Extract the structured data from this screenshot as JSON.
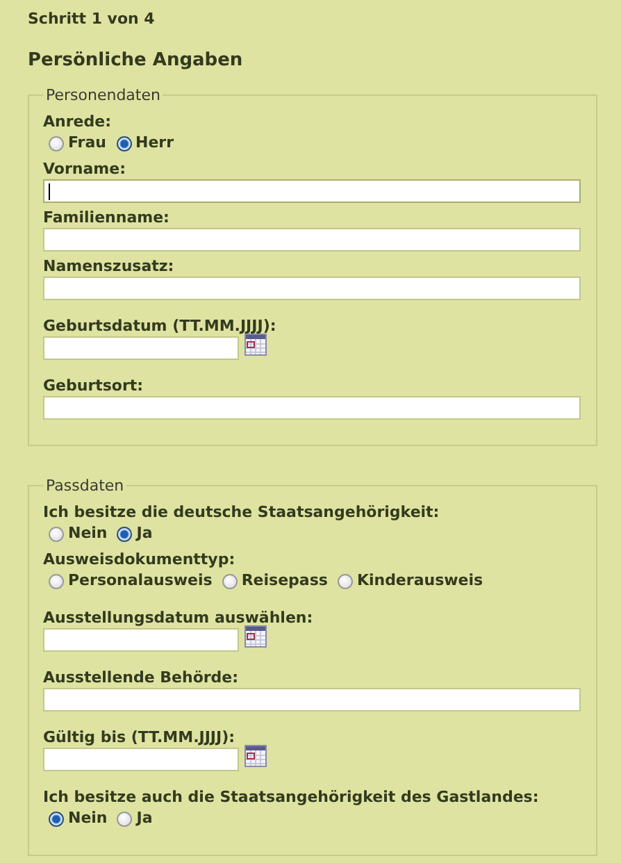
{
  "step": "Schritt 1 von 4",
  "heading": "Persönliche Angaben",
  "sections": [
    {
      "legend": "Personendaten",
      "fields": [
        {
          "kind": "radio",
          "label": "Anrede:",
          "options": [
            {
              "label": "Frau",
              "selected": false
            },
            {
              "label": "Herr",
              "selected": true
            }
          ]
        },
        {
          "kind": "text",
          "label": "Vorname:",
          "focused": true
        },
        {
          "kind": "text",
          "label": "Familienname:",
          "focused": false
        },
        {
          "kind": "text",
          "label": "Namenszusatz:",
          "focused": false
        },
        {
          "kind": "date",
          "label": "Geburtsdatum (TT.MM.JJJJ):"
        },
        {
          "kind": "text",
          "label": "Geburtsort:",
          "focused": false
        }
      ]
    },
    {
      "legend": "Passdaten",
      "fields": [
        {
          "kind": "radio",
          "label": "Ich besitze die deutsche Staatsangehörigkeit:",
          "options": [
            {
              "label": "Nein",
              "selected": false
            },
            {
              "label": "Ja",
              "selected": true
            }
          ]
        },
        {
          "kind": "radio",
          "label": "Ausweisdokumenttyp:",
          "options": [
            {
              "label": "Personalausweis",
              "selected": false
            },
            {
              "label": "Reisepass",
              "selected": false
            },
            {
              "label": "Kinderausweis",
              "selected": false
            }
          ]
        },
        {
          "kind": "date",
          "label": "Ausstellungsdatum auswählen:"
        },
        {
          "kind": "text",
          "label": "Ausstellende Behörde:",
          "focused": false
        },
        {
          "kind": "date",
          "label": "Gültig bis (TT.MM.JJJJ):"
        },
        {
          "kind": "radio",
          "label": "Ich besitze auch die Staatsangehörigkeit des Gastlandes:",
          "options": [
            {
              "label": "Nein",
              "selected": true
            },
            {
              "label": "Ja",
              "selected": false
            }
          ]
        }
      ]
    }
  ]
}
